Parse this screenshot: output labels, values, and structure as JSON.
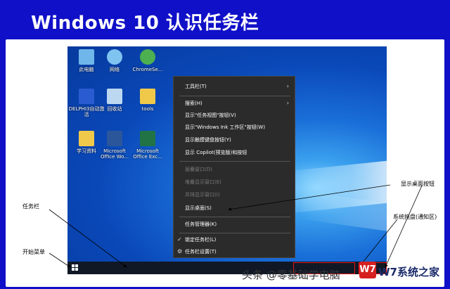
{
  "banner": {
    "title": "Windows 10  认识任务栏"
  },
  "desktop": {
    "icons": [
      {
        "label": "此电脑",
        "color": "#6fb7ea"
      },
      {
        "label": "网络",
        "color": "#7fc4f0"
      },
      {
        "label": "ChromeSe...",
        "color": "#4caf50"
      },
      {
        "label": "DELPHI3自动激活",
        "color": "#2a5bd0"
      },
      {
        "label": "回收站",
        "color": "#bcd7f0"
      },
      {
        "label": "tools",
        "color": "#f1c94a"
      },
      {
        "label": "学习资料",
        "color": "#f1c94a"
      },
      {
        "label": "Microsoft Office Wo...",
        "color": "#2b579a"
      },
      {
        "label": "Microsoft Office Exc...",
        "color": "#217346"
      }
    ]
  },
  "context_menu": {
    "items": [
      {
        "label": "工具栏(T)",
        "disabled": false,
        "submenu": true
      },
      {
        "label": "搜索(H)",
        "disabled": false,
        "submenu": true
      },
      {
        "label": "显示\"任务视图\"按钮(V)",
        "disabled": false
      },
      {
        "label": "显示\"Windows Ink 工作区\"按钮(W)",
        "disabled": false
      },
      {
        "label": "显示触摸键盘按钮(Y)",
        "disabled": false
      },
      {
        "label": "显示 Copilot(预览版)和按钮",
        "disabled": false
      },
      {
        "label": "层叠窗口(D)",
        "disabled": true
      },
      {
        "label": "堆叠显示窗口(E)",
        "disabled": true
      },
      {
        "label": "并排显示窗口(I)",
        "disabled": true
      },
      {
        "label": "显示桌面(S)",
        "disabled": false
      },
      {
        "label": "任务管理器(K)",
        "disabled": false
      },
      {
        "label": "锁定任务栏(L)",
        "disabled": false,
        "checked": true
      },
      {
        "label": "任务栏设置(T)",
        "disabled": false,
        "gear": true
      }
    ]
  },
  "annotations": {
    "taskbar": "任务栏",
    "start_menu": "开始菜单",
    "show_desktop": "显示桌面按钮",
    "system_tray": "系统拖盘(通知区)"
  },
  "watermark": {
    "text": "头条 @零基础学电脑",
    "logo": "W7",
    "site": "W7系统之家"
  }
}
